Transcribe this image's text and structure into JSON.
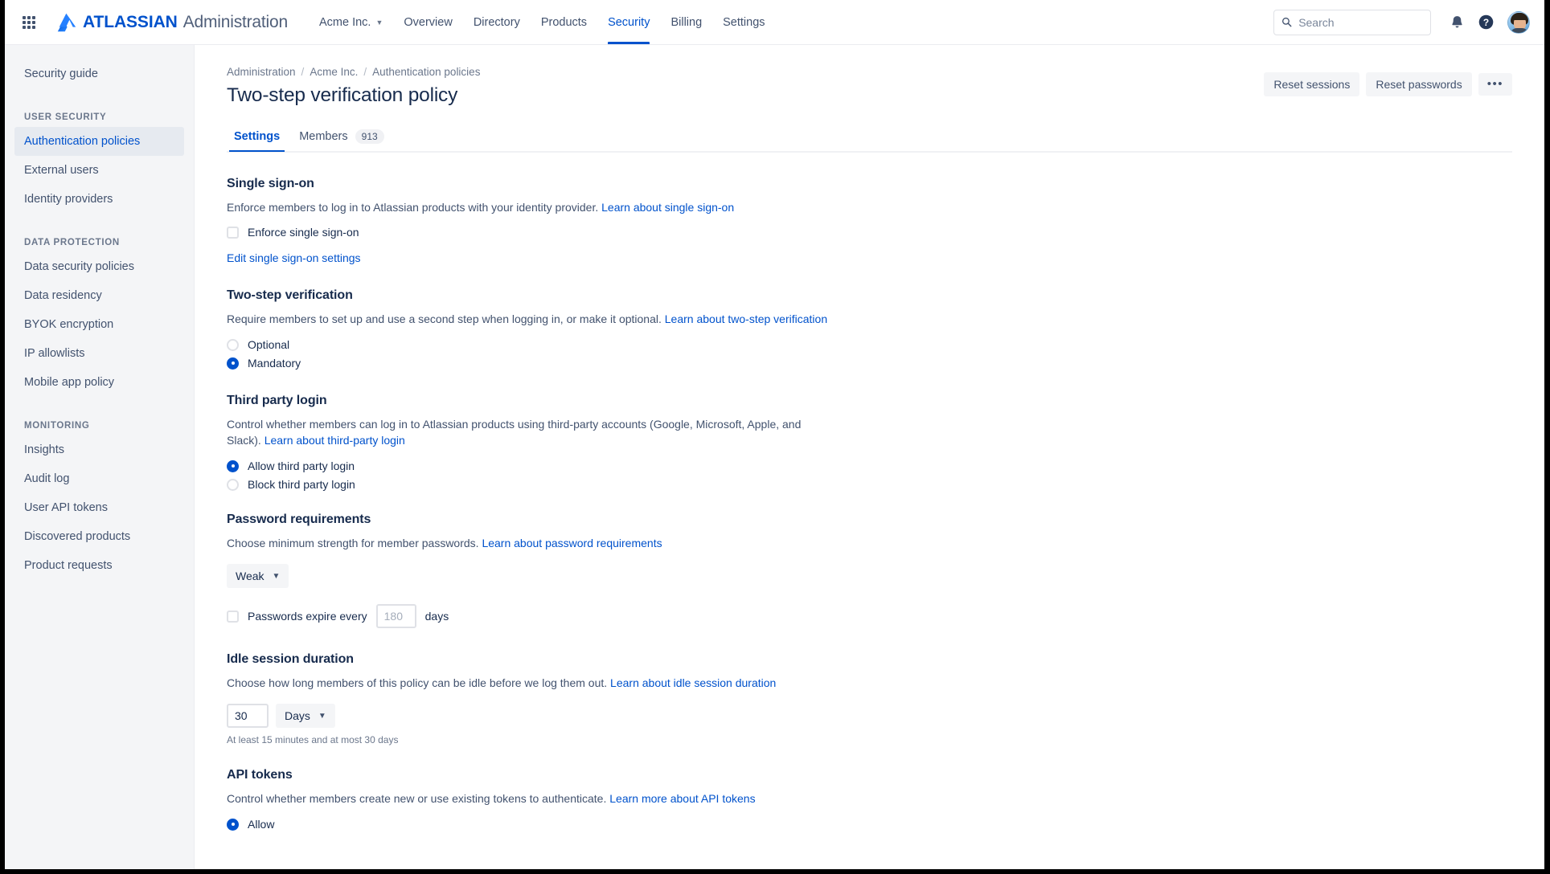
{
  "topnav": {
    "app_switcher_icon": "grid-apps-icon",
    "brand_logo_icon": "atlassian-logo-icon",
    "brand_name": "ATLASSIAN",
    "brand_product": "Administration",
    "org_selector": "Acme Inc.",
    "items": [
      {
        "label": "Overview",
        "active": false
      },
      {
        "label": "Directory",
        "active": false
      },
      {
        "label": "Products",
        "active": false
      },
      {
        "label": "Security",
        "active": true
      },
      {
        "label": "Billing",
        "active": false
      },
      {
        "label": "Settings",
        "active": false
      }
    ],
    "search": {
      "value": "",
      "placeholder": "Search",
      "icon": "search-icon"
    },
    "notifications_icon": "bell-icon",
    "help_icon": "help-circle-icon",
    "avatar": "user-avatar"
  },
  "sidebar": {
    "top_link": "Security guide",
    "groups": [
      {
        "heading": "USER SECURITY",
        "items": [
          {
            "label": "Authentication policies",
            "active": true
          },
          {
            "label": "External users",
            "active": false
          },
          {
            "label": "Identity providers",
            "active": false
          }
        ]
      },
      {
        "heading": "DATA PROTECTION",
        "items": [
          {
            "label": "Data security policies",
            "active": false
          },
          {
            "label": "Data residency",
            "active": false
          },
          {
            "label": "BYOK encryption",
            "active": false
          },
          {
            "label": "IP allowlists",
            "active": false
          },
          {
            "label": "Mobile app policy",
            "active": false
          }
        ]
      },
      {
        "heading": "MONITORING",
        "items": [
          {
            "label": "Insights",
            "active": false
          },
          {
            "label": "Audit log",
            "active": false
          },
          {
            "label": "User API tokens",
            "active": false
          },
          {
            "label": "Discovered products",
            "active": false
          },
          {
            "label": "Product requests",
            "active": false
          }
        ]
      }
    ]
  },
  "page": {
    "breadcrumb": [
      "Administration",
      "Acme Inc.",
      "Authentication policies"
    ],
    "title": "Two-step verification policy",
    "actions": {
      "reset_sessions": "Reset sessions",
      "reset_passwords": "Reset passwords",
      "more": "•••"
    },
    "tabs": [
      {
        "label": "Settings",
        "active": true,
        "badge": ""
      },
      {
        "label": "Members",
        "active": false,
        "badge": "913"
      }
    ]
  },
  "sections": {
    "single_sign_on": {
      "title": "Single sign-on",
      "desc": "Enforce members to log in to Atlassian products with your identity provider.",
      "desc_link": "Learn about single sign-on",
      "checkbox_label": "Enforce single sign-on",
      "checkbox_checked": false,
      "edit_link": "Edit single sign-on settings"
    },
    "two_step": {
      "title": "Two-step verification",
      "desc": "Require members to set up and use a second step when logging in, or make it optional.",
      "desc_link": "Learn about two-step verification",
      "options": [
        {
          "label": "Optional",
          "selected": false
        },
        {
          "label": "Mandatory",
          "selected": true
        }
      ]
    },
    "third_party": {
      "title": "Third party login",
      "desc": "Control whether members can log in to Atlassian products using third-party accounts (Google, Microsoft, Apple, and Slack).",
      "desc_link": "Learn about third-party login",
      "options": [
        {
          "label": "Allow third party login",
          "selected": true
        },
        {
          "label": "Block third party login",
          "selected": false
        }
      ]
    },
    "password_requirements": {
      "title": "Password requirements",
      "desc": "Choose minimum strength for member passwords.",
      "desc_link": "Learn about password requirements",
      "strength_value": "Weak",
      "expire_checkbox_label": "Passwords expire every",
      "expire_checked": false,
      "expire_value": "",
      "expire_placeholder": "180",
      "expire_unit": "days"
    },
    "idle_session": {
      "title": "Idle session duration",
      "desc": "Choose how long members of this policy can be idle before we log them out.",
      "desc_link": "Learn about idle session duration",
      "duration_value": "30",
      "unit_value": "Days",
      "hint": "At least 15 minutes and at most 30 days"
    },
    "api_tokens": {
      "title": "API tokens",
      "desc": "Control whether members create new or use existing tokens to authenticate.",
      "desc_link": "Learn more about API tokens",
      "options": [
        {
          "label": "Allow",
          "selected": true
        }
      ]
    }
  },
  "colors": {
    "brand_blue": "#0052cc",
    "link_blue": "#0052cc",
    "text_dark": "#172b4d",
    "text_muted": "#6b778c",
    "sidebar_bg": "#f4f5f7"
  }
}
